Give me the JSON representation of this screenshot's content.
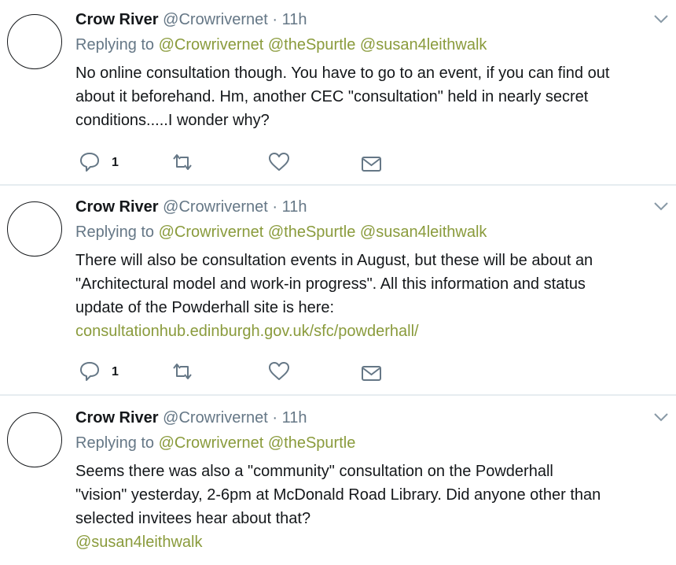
{
  "tweets": [
    {
      "name": "Crow River",
      "handle": "@Crowrivernet",
      "time": "· 11h",
      "replying_label": "Replying to",
      "replying_to": [
        "@Crowrivernet",
        "@theSpurtle",
        "@susan4leithwalk"
      ],
      "text_lines": [
        "No online consultation though. You have to go to an event, if you can find out",
        "about it beforehand. Hm, another CEC \"consultation\" held in nearly secret",
        "conditions.....I wonder why?"
      ],
      "link": "",
      "reply_count": "1"
    },
    {
      "name": "Crow River",
      "handle": "@Crowrivernet",
      "time": "· 11h",
      "replying_label": "Replying to",
      "replying_to": [
        "@Crowrivernet",
        "@theSpurtle",
        "@susan4leithwalk"
      ],
      "text_lines": [
        "There will also be consultation events in August, but these will be about an",
        "\"Architectural model and work-in progress\". All this information and status",
        "update of the Powderhall site is here:"
      ],
      "link": "consultationhub.edinburgh.gov.uk/sfc/powderhall/",
      "reply_count": "1"
    },
    {
      "name": "Crow River",
      "handle": "@Crowrivernet",
      "time": "· 11h",
      "replying_label": "Replying to",
      "replying_to": [
        "@Crowrivernet",
        "@theSpurtle"
      ],
      "text_lines": [
        "Seems there was also a \"community\" consultation on the Powderhall",
        "\"vision\" yesterday, 2-6pm at McDonald Road Library. Did anyone other than",
        "selected invitees hear about that?"
      ],
      "link": "@susan4leithwalk",
      "reply_count": ""
    }
  ],
  "colors": {
    "accent": "#8a9b3c",
    "muted": "#657786",
    "text": "#14171a",
    "divider": "#e6ecf0"
  },
  "icons": {
    "reply": "reply-icon",
    "retweet": "retweet-icon",
    "like": "heart-icon",
    "dm": "envelope-icon",
    "menu": "chevron-down-icon"
  }
}
